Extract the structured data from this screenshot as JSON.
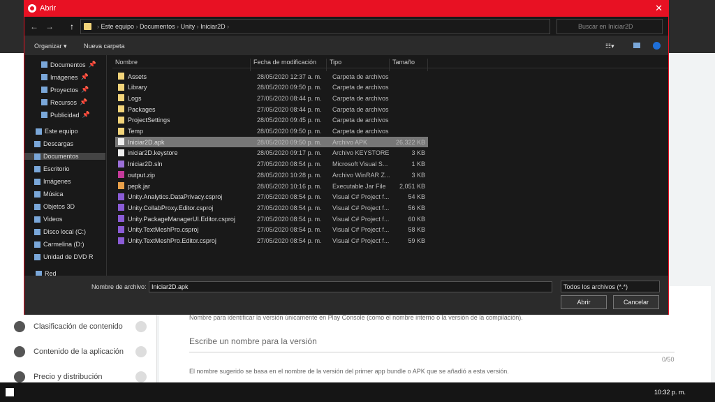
{
  "dialog": {
    "title": "Abrir",
    "close": "✕",
    "path": [
      "Este equipo",
      "Documentos",
      "Unity",
      "Iniciar2D"
    ],
    "search_placeholder": "Buscar en Iniciar2D",
    "toolbar": {
      "organize": "Organizar ▾",
      "new_folder": "Nueva carpeta"
    },
    "nav": [
      {
        "label": "Documentos",
        "pin": true
      },
      {
        "label": "Imágenes",
        "pin": true
      },
      {
        "label": "Proyectos",
        "pin": true
      },
      {
        "label": "Recursos",
        "pin": true
      },
      {
        "label": "Publicidad",
        "pin": true
      },
      {
        "label": "Este equipo"
      },
      {
        "label": "Descargas"
      },
      {
        "label": "Documentos",
        "selected": true
      },
      {
        "label": "Escritorio"
      },
      {
        "label": "Imágenes"
      },
      {
        "label": "Música"
      },
      {
        "label": "Objetos 3D"
      },
      {
        "label": "Videos"
      },
      {
        "label": "Disco local (C:)"
      },
      {
        "label": "Carmelina (D:)"
      },
      {
        "label": "Unidad de DVD R"
      },
      {
        "label": "Red"
      }
    ],
    "columns": [
      "Nombre",
      "Fecha de modificación",
      "Tipo",
      "Tamaño"
    ],
    "files": [
      {
        "name": "Assets",
        "date": "28/05/2020 12:37 a. m.",
        "type": "Carpeta de archivos",
        "size": "",
        "icon": "folder"
      },
      {
        "name": "Library",
        "date": "28/05/2020 09:50 p. m.",
        "type": "Carpeta de archivos",
        "size": "",
        "icon": "folder"
      },
      {
        "name": "Logs",
        "date": "27/05/2020 08:44 p. m.",
        "type": "Carpeta de archivos",
        "size": "",
        "icon": "folder"
      },
      {
        "name": "Packages",
        "date": "27/05/2020 08:44 p. m.",
        "type": "Carpeta de archivos",
        "size": "",
        "icon": "folder"
      },
      {
        "name": "ProjectSettings",
        "date": "28/05/2020 09:45 p. m.",
        "type": "Carpeta de archivos",
        "size": "",
        "icon": "folder"
      },
      {
        "name": "Temp",
        "date": "28/05/2020 09:50 p. m.",
        "type": "Carpeta de archivos",
        "size": "",
        "icon": "folder"
      },
      {
        "name": "Iniciar2D.apk",
        "date": "28/05/2020 09:50 p. m.",
        "type": "Archivo APK",
        "size": "26,322 KB",
        "icon": "file",
        "selected": true
      },
      {
        "name": "iniciar2D.keystore",
        "date": "28/05/2020 09:17 p. m.",
        "type": "Archivo KEYSTORE",
        "size": "3 KB",
        "icon": "file"
      },
      {
        "name": "Iniciar2D.sln",
        "date": "27/05/2020 08:54 p. m.",
        "type": "Microsoft Visual S...",
        "size": "1 KB",
        "icon": "sln"
      },
      {
        "name": "output.zip",
        "date": "28/05/2020 10:28 p. m.",
        "type": "Archivo WinRAR Z...",
        "size": "3 KB",
        "icon": "zip"
      },
      {
        "name": "pepk.jar",
        "date": "28/05/2020 10:16 p. m.",
        "type": "Executable Jar File",
        "size": "2,051 KB",
        "icon": "jar"
      },
      {
        "name": "Unity.Analytics.DataPrivacy.csproj",
        "date": "27/05/2020 08:54 p. m.",
        "type": "Visual C# Project f...",
        "size": "54 KB",
        "icon": "csproj"
      },
      {
        "name": "Unity.CollabProxy.Editor.csproj",
        "date": "27/05/2020 08:54 p. m.",
        "type": "Visual C# Project f...",
        "size": "56 KB",
        "icon": "csproj"
      },
      {
        "name": "Unity.PackageManagerUI.Editor.csproj",
        "date": "27/05/2020 08:54 p. m.",
        "type": "Visual C# Project f...",
        "size": "60 KB",
        "icon": "csproj"
      },
      {
        "name": "Unity.TextMeshPro.csproj",
        "date": "27/05/2020 08:54 p. m.",
        "type": "Visual C# Project f...",
        "size": "58 KB",
        "icon": "csproj"
      },
      {
        "name": "Unity.TextMeshPro.Editor.csproj",
        "date": "27/05/2020 08:54 p. m.",
        "type": "Visual C# Project f...",
        "size": "59 KB",
        "icon": "csproj"
      }
    ],
    "filename_label": "Nombre de archivo:",
    "filename_value": "Iniciar2D.apk",
    "filter": "Todos los archivos (*.*)",
    "open": "Abrir",
    "cancel": "Cancelar"
  },
  "page": {
    "side": [
      "Clasificación de contenido",
      "Contenido de la aplicación",
      "Precio y distribución"
    ],
    "hint1": "Nombre para identificar la versión únicamente en Play Console (como el nombre interno o la versión de la compilación).",
    "placeholder": "Escribe un nombre para la versión",
    "counter": "0/50",
    "hint2": "El nombre sugerido se basa en el nombre de la versión del primer app bundle o APK que se añadió a esta versión."
  },
  "taskbar": {
    "time": "10:32 p. m."
  },
  "colors": {
    "accent": "#e81123",
    "dialog_bg": "#191919"
  }
}
